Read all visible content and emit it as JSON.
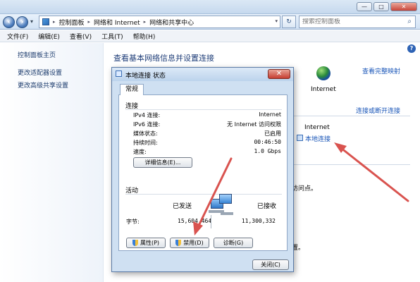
{
  "window": {
    "controls": {
      "minimize": "—",
      "maximize": "□",
      "close": "✕"
    }
  },
  "address": {
    "crumbs": [
      "控制面板",
      "网络和 Internet",
      "网络和共享中心"
    ],
    "refresh_icon": "refresh-icon"
  },
  "search": {
    "placeholder": "搜索控制面板"
  },
  "menu": [
    "文件(F)",
    "编辑(E)",
    "查看(V)",
    "工具(T)",
    "帮助(H)"
  ],
  "sidebar": {
    "items": [
      {
        "label": "控制面板主页"
      },
      {
        "label": "更改适配器设置"
      },
      {
        "label": "更改高级共享设置"
      }
    ]
  },
  "main": {
    "heading": "查看基本网络信息并设置连接",
    "full_map": "查看完整映射",
    "internet_label": "Internet",
    "connect_link": "连接或断开连接",
    "access_type": "Internet",
    "local_connection": "本地连接",
    "fragment1": "访问点。",
    "fragment2": "置。"
  },
  "dialog": {
    "title": "本地连接 状态",
    "tab": "常规",
    "connection_label": "连接",
    "rows": [
      {
        "key": "IPv4 连接:",
        "value": "Internet"
      },
      {
        "key": "IPv6 连接:",
        "value": "无 Internet 访问权限"
      },
      {
        "key": "媒体状态:",
        "value": "已启用"
      },
      {
        "key": "持续时间:",
        "value": "00:46:50"
      },
      {
        "key": "速度:",
        "value": "1.0 Gbps"
      }
    ],
    "details_button": "详细信息(E)...",
    "activity_label": "活动",
    "sent_label": "已发送",
    "received_label": "已接收",
    "bytes_label": "字节:",
    "bytes_sent": "15,604,464",
    "bytes_received": "11,300,332",
    "properties_button": "属性(P)",
    "disable_button": "禁用(D)",
    "diagnose_button": "诊断(G)",
    "close_button": "关闭(C)"
  },
  "colors": {
    "annotation_arrow": "#d9534f",
    "link": "#1a56b8"
  }
}
